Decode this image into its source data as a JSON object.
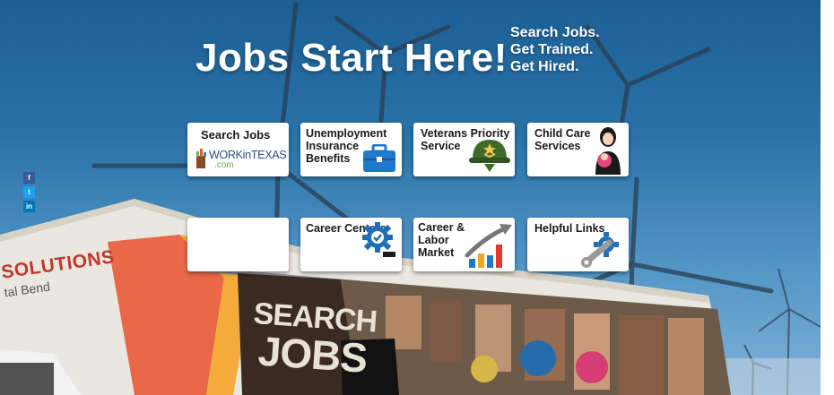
{
  "hero": {
    "headline": "Jobs Start Here!",
    "tagline": [
      "Search Jobs.",
      "Get Trained.",
      "Get Hired."
    ]
  },
  "tiles": [
    {
      "label": "Search Jobs",
      "logo_main": "WORKinTEXAS",
      "logo_sub": ".com",
      "icon": "workintexas-logo"
    },
    {
      "label": "Unemployment Insurance Benefits",
      "icon": "briefcase-icon"
    },
    {
      "label": "Veterans Priority Service",
      "icon": "military-helmet-icon"
    },
    {
      "label": "Child Care Services",
      "icon": "caregiver-icon"
    },
    {
      "label": "",
      "icon": "partially-hidden"
    },
    {
      "label": "Career Centers",
      "icon": "gear-check-icon"
    },
    {
      "label": "Career & Labor Market",
      "icon": "growth-chart-icon"
    },
    {
      "label": "Helpful Links",
      "icon": "wrench-gear-icon"
    }
  ],
  "share": [
    {
      "glyph": "f",
      "network": "facebook",
      "color": "#3b5998"
    },
    {
      "glyph": "t",
      "network": "twitter",
      "color": "#1da1f2"
    },
    {
      "glyph": "in",
      "network": "linkedin",
      "color": "#0077b5"
    }
  ],
  "truck": {
    "side_text": "SOLUTIONS",
    "side_subtext": "tal Bend",
    "panel_line1": "SEARCH",
    "panel_line2": "JOBS"
  }
}
